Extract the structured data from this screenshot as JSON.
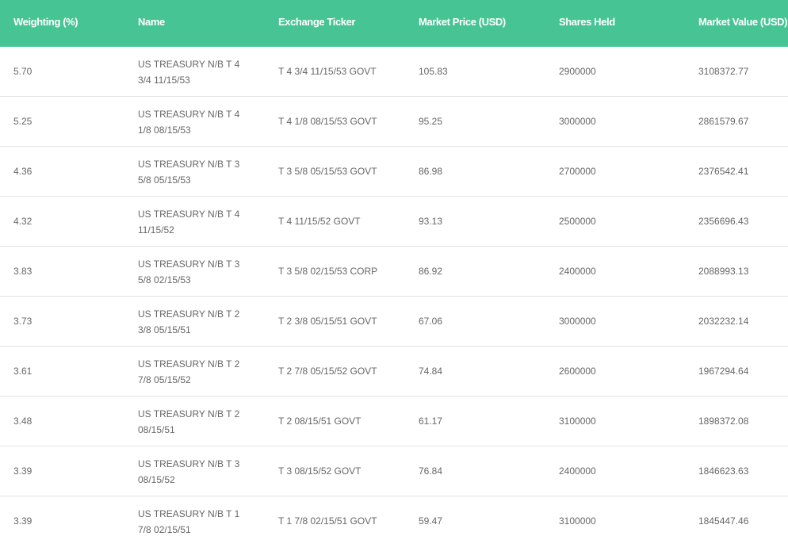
{
  "table": {
    "headers": [
      "Weighting (%)",
      "Name",
      "Exchange Ticker",
      "Market Price (USD)",
      "Shares Held",
      "Market Value (USD)"
    ],
    "rows": [
      {
        "weighting": "5.70",
        "name_line1": "US TREASURY N/B T 4",
        "name_line2": "3/4 11/15/53",
        "ticker": "T 4 3/4 11/15/53 GOVT",
        "price": "105.83",
        "shares": "2900000",
        "value": "3108372.77"
      },
      {
        "weighting": "5.25",
        "name_line1": "US TREASURY N/B T 4",
        "name_line2": "1/8 08/15/53",
        "ticker": "T 4 1/8 08/15/53 GOVT",
        "price": "95.25",
        "shares": "3000000",
        "value": "2861579.67"
      },
      {
        "weighting": "4.36",
        "name_line1": "US TREASURY N/B T 3",
        "name_line2": "5/8 05/15/53",
        "ticker": "T 3 5/8 05/15/53 GOVT",
        "price": "86.98",
        "shares": "2700000",
        "value": "2376542.41"
      },
      {
        "weighting": "4.32",
        "name_line1": "US TREASURY N/B T 4",
        "name_line2": "11/15/52",
        "ticker": "T 4 11/15/52 GOVT",
        "price": "93.13",
        "shares": "2500000",
        "value": "2356696.43"
      },
      {
        "weighting": "3.83",
        "name_line1": "US TREASURY N/B T 3",
        "name_line2": "5/8 02/15/53",
        "ticker": "T 3 5/8 02/15/53 CORP",
        "price": "86.92",
        "shares": "2400000",
        "value": "2088993.13"
      },
      {
        "weighting": "3.73",
        "name_line1": "US TREASURY N/B T 2",
        "name_line2": "3/8 05/15/51",
        "ticker": "T 2 3/8 05/15/51 GOVT",
        "price": "67.06",
        "shares": "3000000",
        "value": "2032232.14"
      },
      {
        "weighting": "3.61",
        "name_line1": "US TREASURY N/B T 2",
        "name_line2": "7/8 05/15/52",
        "ticker": "T 2 7/8 05/15/52 GOVT",
        "price": "74.84",
        "shares": "2600000",
        "value": "1967294.64"
      },
      {
        "weighting": "3.48",
        "name_line1": "US TREASURY N/B T 2",
        "name_line2": "08/15/51",
        "ticker": "T 2 08/15/51 GOVT",
        "price": "61.17",
        "shares": "3100000",
        "value": "1898372.08"
      },
      {
        "weighting": "3.39",
        "name_line1": "US TREASURY N/B T 3",
        "name_line2": "08/15/52",
        "ticker": "T 3 08/15/52 GOVT",
        "price": "76.84",
        "shares": "2400000",
        "value": "1846623.63"
      },
      {
        "weighting": "3.39",
        "name_line1": "US TREASURY N/B T 1",
        "name_line2": "7/8 02/15/51",
        "ticker": "T 1 7/8 02/15/51 GOVT",
        "price": "59.47",
        "shares": "3100000",
        "value": "1845447.46"
      }
    ]
  }
}
